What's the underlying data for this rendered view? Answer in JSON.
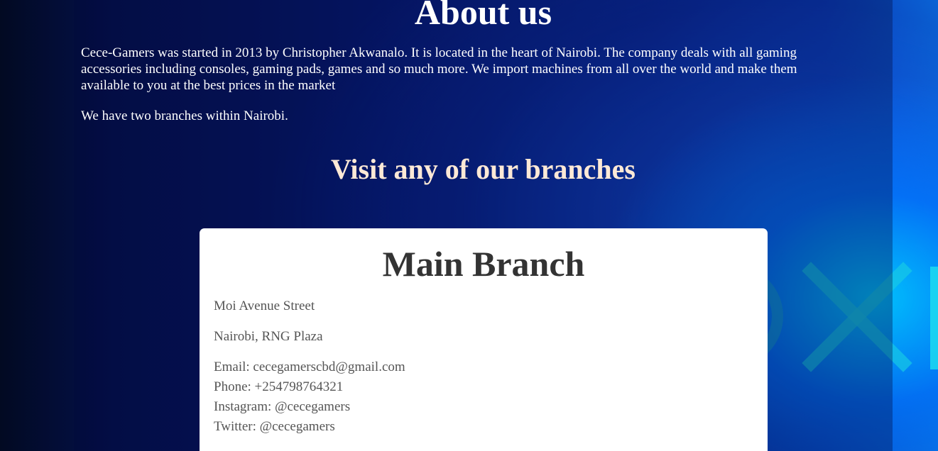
{
  "about": {
    "title": "About us",
    "paragraph1": "Cece-Gamers was started in 2013 by Christopher Akwanalo. It is located in the heart of Nairobi. The company deals with all gaming accessories including consoles, gaming pads, games and so much more. We import machines from all over the world and make them available to you at the best prices in the market",
    "paragraph2": "We have two branches within Nairobi."
  },
  "branches": {
    "heading": "Visit any of our branches",
    "main_branch": {
      "title": "Main Branch",
      "street": "Moi Avenue Street",
      "location": "Nairobi, RNG Plaza",
      "email": "Email: cecegamerscbd@gmail.com",
      "phone": "Phone: +254798764321",
      "instagram": "Instagram: @cecegamers",
      "twitter": "Twitter: @cecegamers"
    }
  },
  "colors": {
    "background_dark": "#04104a",
    "background_accent": "#00c8ff",
    "heading_text": "#ffffff",
    "subheading_text": "#fde9d6",
    "card_bg": "#ffffff",
    "card_title": "#333333",
    "card_text": "#555555"
  },
  "icons": {
    "background_symbols": [
      "playstation-circle-icon",
      "playstation-cross-icon"
    ]
  }
}
